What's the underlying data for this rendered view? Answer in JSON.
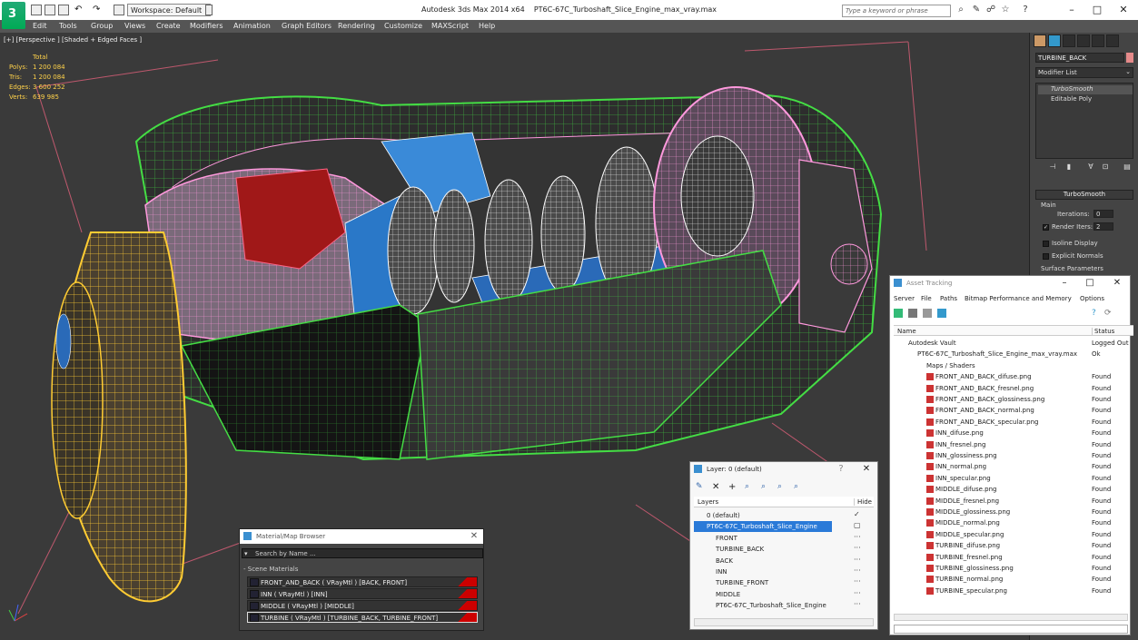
{
  "title_bar": {
    "workspace_label": "Workspace: Default",
    "app_title": "Autodesk 3ds Max  2014 x64",
    "file_title": "PT6C-67C_Turboshaft_Slice_Engine_max_vray.max",
    "search_placeholder": "Type a keyword or phrase"
  },
  "menu": [
    "Edit",
    "Tools",
    "Group",
    "Views",
    "Create",
    "Modifiers",
    "Animation",
    "Graph Editors",
    "Rendering",
    "Customize",
    "MAXScript",
    "Help"
  ],
  "viewport": {
    "label": "[+] [Perspective ] [Shaded + Edged Faces ]",
    "stats_header": "Total",
    "stats": [
      {
        "label": "Polys:",
        "value": "1 200 084"
      },
      {
        "label": "Tris:",
        "value": "1 200 084"
      },
      {
        "label": "Edges:",
        "value": "3 600 252"
      },
      {
        "label": "Verts:",
        "value": "639 985"
      }
    ]
  },
  "command_panel": {
    "object_name": "TURBINE_BACK",
    "object_color": "#e58a8a",
    "modifier_list_label": "Modifier List",
    "stack": [
      "TurboSmooth",
      "Editable Poly"
    ],
    "rollout_title": "TurboSmooth",
    "main_label": "Main",
    "iterations_label": "Iterations:",
    "iterations_value": "0",
    "render_iters_label": "Render Iters:",
    "render_iters_value": "2",
    "isoline_label": "Isoline Display",
    "explicit_label": "Explicit Normals",
    "surface_label": "Surface Parameters"
  },
  "asset_tracking": {
    "title": "Asset Tracking",
    "menu": [
      "Server",
      "File",
      "Paths",
      "Bitmap Performance and Memory",
      "Options"
    ],
    "columns": [
      "Name",
      "Status"
    ],
    "rows": [
      {
        "name": "Autodesk Vault",
        "status": "Logged Out"
      },
      {
        "name": "PT6C-67C_Turboshaft_Slice_Engine_max_vray.max",
        "status": "Ok"
      },
      {
        "name": "Maps / Shaders",
        "status": ""
      },
      {
        "name": "FRONT_AND_BACK_difuse.png",
        "status": "Found"
      },
      {
        "name": "FRONT_AND_BACK_fresnel.png",
        "status": "Found"
      },
      {
        "name": "FRONT_AND_BACK_glossiness.png",
        "status": "Found"
      },
      {
        "name": "FRONT_AND_BACK_normal.png",
        "status": "Found"
      },
      {
        "name": "FRONT_AND_BACK_specular.png",
        "status": "Found"
      },
      {
        "name": "INN_difuse.png",
        "status": "Found"
      },
      {
        "name": "INN_fresnel.png",
        "status": "Found"
      },
      {
        "name": "INN_glossiness.png",
        "status": "Found"
      },
      {
        "name": "INN_normal.png",
        "status": "Found"
      },
      {
        "name": "INN_specular.png",
        "status": "Found"
      },
      {
        "name": "MIDDLE_difuse.png",
        "status": "Found"
      },
      {
        "name": "MIDDLE_fresnel.png",
        "status": "Found"
      },
      {
        "name": "MIDDLE_glossiness.png",
        "status": "Found"
      },
      {
        "name": "MIDDLE_normal.png",
        "status": "Found"
      },
      {
        "name": "MIDDLE_specular.png",
        "status": "Found"
      },
      {
        "name": "TURBINE_difuse.png",
        "status": "Found"
      },
      {
        "name": "TURBINE_fresnel.png",
        "status": "Found"
      },
      {
        "name": "TURBINE_glossiness.png",
        "status": "Found"
      },
      {
        "name": "TURBINE_normal.png",
        "status": "Found"
      },
      {
        "name": "TURBINE_specular.png",
        "status": "Found"
      }
    ]
  },
  "layer_manager": {
    "title": "Layer: 0 (default)",
    "columns": [
      "Layers",
      "Hide"
    ],
    "rows": [
      {
        "name": "0 (default)"
      },
      {
        "name": "PT6C-67C_Turboshaft_Slice_Engine"
      },
      {
        "name": "FRONT"
      },
      {
        "name": "TURBINE_BACK"
      },
      {
        "name": "BACK"
      },
      {
        "name": "INN"
      },
      {
        "name": "TURBINE_FRONT"
      },
      {
        "name": "MIDDLE"
      },
      {
        "name": "PT6C-67C_Turboshaft_Slice_Engine"
      }
    ]
  },
  "material_browser": {
    "title": "Material/Map Browser",
    "search_placeholder": "Search by Name ...",
    "group_label": "- Scene Materials",
    "rows": [
      "FRONT_AND_BACK  ( VRayMtl )  [BACK, FRONT]",
      "INN  ( VRayMtl )  [INN]",
      "MIDDLE  ( VRayMtl )  [MIDDLE]",
      "TURBINE  ( VRayMtl )  [TURBINE_BACK, TURBINE_FRONT]"
    ]
  }
}
